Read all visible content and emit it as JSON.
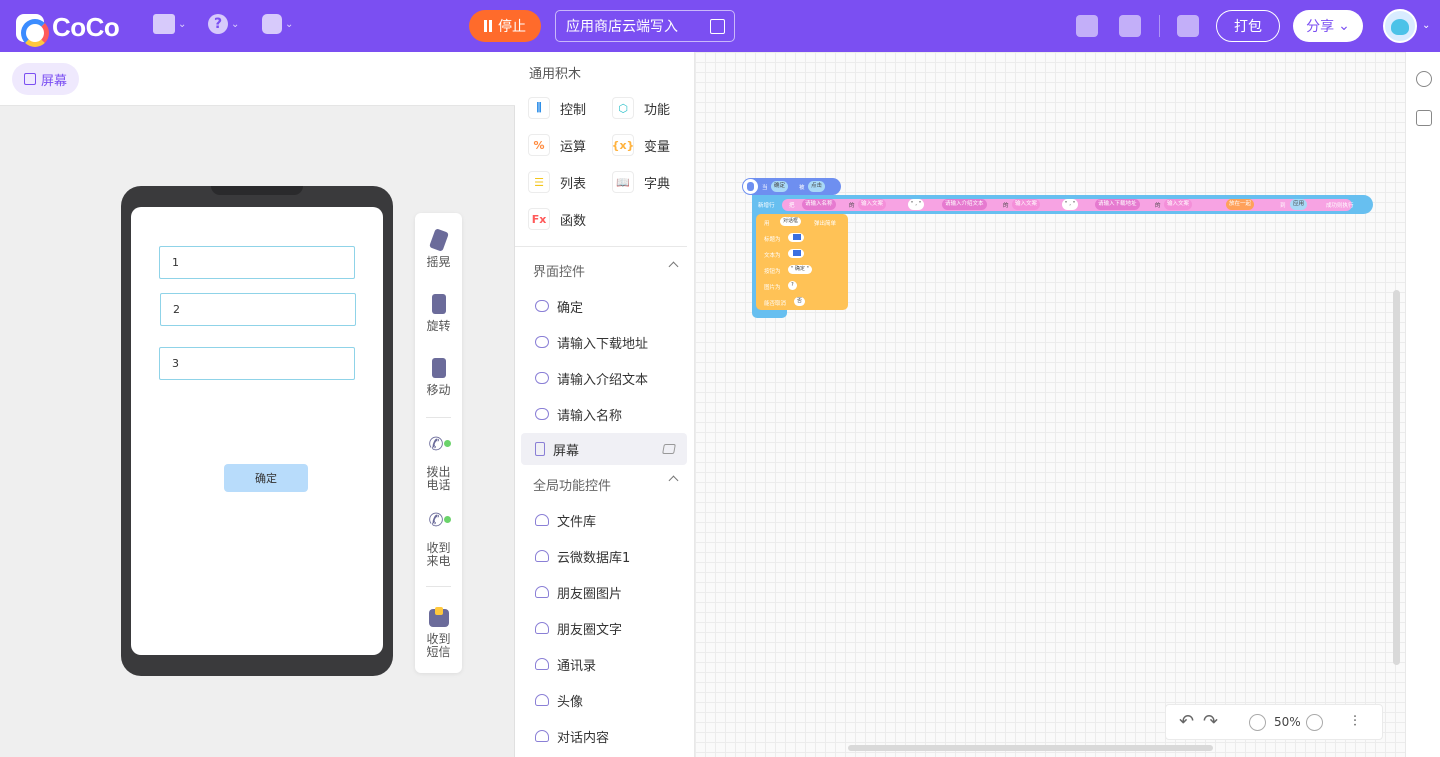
{
  "app": {
    "name": "CoCo"
  },
  "header": {
    "stop_label": "停止",
    "write_label": "应用商店云端写入",
    "pack_label": "打包",
    "share_label": "分享",
    "help_glyph": "?"
  },
  "stage": {
    "screen_tab": "屏幕",
    "inputs": [
      "1",
      "2",
      "3"
    ],
    "button_label": "确定",
    "sensors": [
      "摇晃",
      "旋转",
      "移动",
      "拨出电话",
      "收到来电",
      "收到短信"
    ]
  },
  "blocks_panel": {
    "general_title": "通用积木",
    "categories": [
      {
        "label": "控制",
        "icon": "sliders-icon",
        "color": "#2f8fe8"
      },
      {
        "label": "功能",
        "icon": "cube-icon",
        "color": "#2ac0c9"
      },
      {
        "label": "运算",
        "icon": "percent-icon",
        "color": "#ff8a3d"
      },
      {
        "label": "变量",
        "icon": "variable-icon",
        "color": "#ffb23d"
      },
      {
        "label": "列表",
        "icon": "list-icon",
        "color": "#f3c61c"
      },
      {
        "label": "字典",
        "icon": "book-icon",
        "color": "#7b4ff2"
      },
      {
        "label": "函数",
        "icon": "fx-icon",
        "color": "#ff5a5a"
      }
    ],
    "ui_group": "界面控件",
    "ui_controls": [
      "确定",
      "请输入下载地址",
      "请输入介绍文本",
      "请输入名称",
      "屏幕"
    ],
    "global_group": "全局功能控件",
    "global_controls": [
      "文件库",
      "云微数据库1",
      "朋友圈图片",
      "朋友圈文字",
      "通讯录",
      "头像",
      "对话内容"
    ]
  },
  "workspace": {
    "zoom": "50%",
    "code": {
      "hat": {
        "when": "当",
        "target": "确定",
        "is": "被",
        "event": "点击"
      },
      "exec": {
        "new_thread": "新增行",
        "to": "把",
        "name_field": "请输入名称",
        "of1": "的",
        "prop1": "输入文案",
        "sep1": "\" , \"",
        "intro_field": "请输入介绍文本",
        "of2": "的",
        "prop2": "输入文案",
        "sep2": "\" , \"",
        "url_field": "请输入下载地址",
        "of3": "的",
        "prop3": "输入文案",
        "join": "放在一起",
        "into": "到",
        "target": "应用",
        "success": "成功则执行"
      },
      "dialog": {
        "use": "用",
        "kind": "对话框",
        "popup": "弹出简单",
        "title": "标题为",
        "text": "文本为",
        "button": "按钮为",
        "button_val": "\" 确定 \"",
        "image": "图片为",
        "image_val": "?",
        "cancel": "能否取消",
        "cancel_val": "否"
      }
    }
  }
}
